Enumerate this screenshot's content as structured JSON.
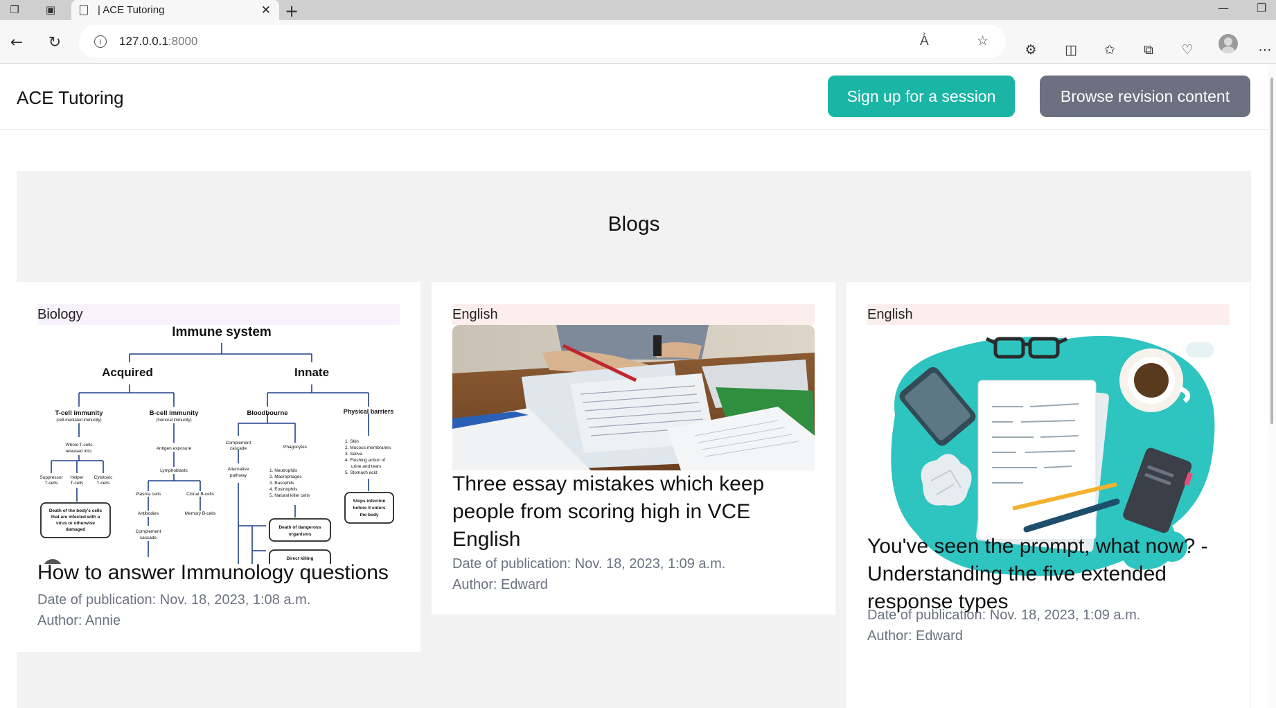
{
  "browser": {
    "tab_title": "| ACE Tutoring",
    "url_host": "127.0.0.1",
    "url_port": ":8000"
  },
  "site": {
    "brand": "ACE Tutoring",
    "signup_label": "Sign up for a session",
    "browse_label": "Browse revision content",
    "accent_color": "#1ab5a5",
    "secondary_color": "#6b7180"
  },
  "blogs": {
    "heading": "Blogs",
    "posts": [
      {
        "category": "Biology",
        "category_color": "#f8f2fd",
        "title": "How to answer Immunology questions",
        "date": "Date of publication: Nov. 18, 2023, 1:08 a.m.",
        "author": "Author: Annie",
        "diagram": {
          "root": "Immune system",
          "acquired": "Acquired",
          "innate": "Innate",
          "tcell": "T-cell immunity",
          "tcell_sub": "(cell-mediated immunity)",
          "bcell": "B-cell immunity",
          "bcell_sub": "(humoral immunity)",
          "blood": "Bloodbourne",
          "physical": "Physical barriers",
          "whole_t": "Whole T-cells",
          "released": "released into:",
          "antigen": "Antigen exposure",
          "complement": "Complement",
          "cascade": "cascade",
          "phagocytes": "Phagocytes",
          "supp": "Suppressor",
          "helper": "Helper",
          "cyto": "Cytotoxic",
          "tcells": "T-cells",
          "lympho": "Lymphoblasts",
          "alt": "Alternative",
          "pathway": "pathway",
          "neut": "1. Neutrophils",
          "macro": "2. Macrophages",
          "baso": "3. Basophils",
          "eosino": "4. Eosinophils",
          "nk": "5. Natural killer cells",
          "skin": "1. Skin",
          "mucous": "2. Mucous membranes",
          "saliva": "3. Saliva",
          "flush": "4. Flushing action of",
          "urine": "urine and tears",
          "stomach": "5. Stomach acid",
          "plasma": "Plasma cells",
          "clonal": "Clonal B-cells",
          "antibodies": "Antibodies",
          "memory": "Memory B-cells",
          "complement2": "Complement",
          "cascade2": "cascade",
          "death1": "Death of the body's cells",
          "death2": "that are infected with a",
          "death3": "virus or otherwise",
          "death4": "damaged",
          "dd1": "Death of dangerous",
          "dd2": "organisms",
          "stop1": "Stops infection",
          "stop2": "before it enters",
          "stop3": "the body",
          "direct": "Direct killing"
        }
      },
      {
        "category": "English",
        "category_color": "#fdeeee",
        "title": "Three essay mistakes which keep people from scoring high in VCE English",
        "date": "Date of publication: Nov. 18, 2023, 1:09 a.m.",
        "author": "Author: Edward"
      },
      {
        "category": "English",
        "category_color": "#fdeeee",
        "title": "You've seen the prompt, what now? - Understanding the five extended response types",
        "date": "Date of publication: Nov. 18, 2023, 1:09 a.m.",
        "author": "Author: Edward"
      }
    ]
  }
}
